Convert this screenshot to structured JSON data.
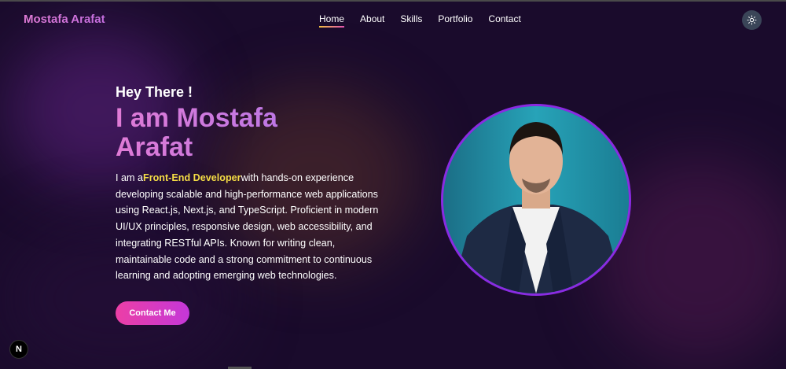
{
  "brand": {
    "logo": "Mostafa Arafat"
  },
  "nav": {
    "links": [
      {
        "label": "Home",
        "active": true
      },
      {
        "label": "About",
        "active": false
      },
      {
        "label": "Skills",
        "active": false
      },
      {
        "label": "Portfolio",
        "active": false
      },
      {
        "label": "Contact",
        "active": false
      }
    ],
    "theme_icon": "sun-icon"
  },
  "hero": {
    "greeting": "Hey There !",
    "name": "I am Mostafa Arafat",
    "bio_prefix": "I am a",
    "bio_highlight": "Front-End Developer",
    "bio_suffix": "with hands-on experience developing scalable and high-performance web applications using React.js, Next.js, and TypeScript. Proficient in modern UI/UX principles, responsive design, web accessibility, and integrating RESTful APIs. Known for writing clean, maintainable code and a strong commitment to continuous learning and adopting emerging web technologies.",
    "cta_label": "Contact Me"
  },
  "dev_badge": {
    "label": "N"
  },
  "colors": {
    "background": "#1a0b2c",
    "accent_pink": "#ec3fa6",
    "accent_purple": "#c437d8",
    "highlight_yellow": "#f5dd45",
    "avatar_border": "#8a2be2"
  }
}
